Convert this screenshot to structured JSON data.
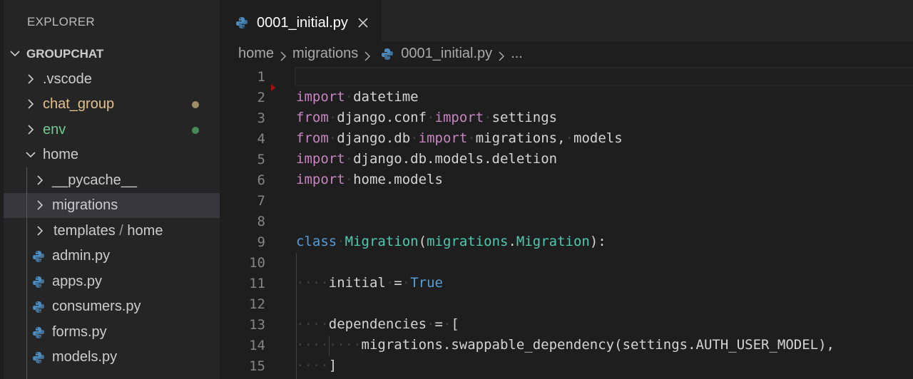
{
  "sidebar": {
    "title": "EXPLORER",
    "root": "GROUPCHAT",
    "items": [
      {
        "label": ".vscode",
        "kind": "folder"
      },
      {
        "label": "chat_group",
        "kind": "folder",
        "status": "modified",
        "status_color": "#a08c68"
      },
      {
        "label": "env",
        "kind": "folder",
        "status": "untracked",
        "status_color": "#478a57"
      },
      {
        "label": "home",
        "kind": "folder-open"
      },
      {
        "label": "__pycache__",
        "kind": "folder"
      },
      {
        "label": "migrations",
        "kind": "folder",
        "selected": true
      },
      {
        "label": "templates",
        "label_suffix": "home",
        "separator": "/",
        "kind": "folder"
      },
      {
        "label": "admin.py",
        "kind": "python-file"
      },
      {
        "label": "apps.py",
        "kind": "python-file"
      },
      {
        "label": "consumers.py",
        "kind": "python-file"
      },
      {
        "label": "forms.py",
        "kind": "python-file"
      },
      {
        "label": "models.py",
        "kind": "python-file"
      }
    ]
  },
  "tab": {
    "label": "0001_initial.py",
    "icon": "python-icon"
  },
  "breadcrumb": [
    "home",
    "migrations",
    "0001_initial.py",
    "..."
  ],
  "editor": {
    "line_numbers": [
      "1",
      "2",
      "3",
      "4",
      "5",
      "6",
      "7",
      "8",
      "9",
      "10",
      "11",
      "12",
      "13",
      "14",
      "15"
    ]
  },
  "colors": {
    "keyword_import": "#c586c0",
    "keyword": "#569cd6",
    "class": "#4ec9b0",
    "text": "#d4d4d4"
  }
}
